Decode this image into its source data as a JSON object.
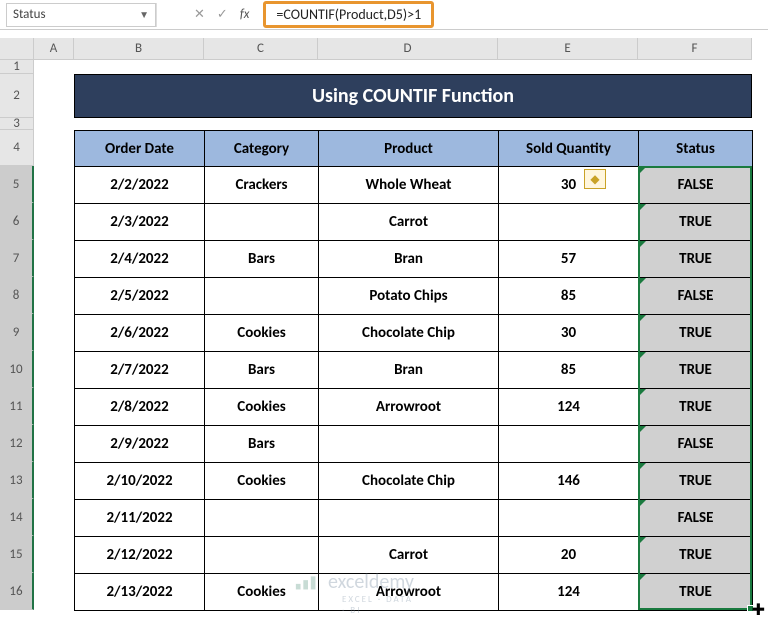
{
  "nameBox": "Status",
  "formula": "=COUNTIF(Product,D5)>1",
  "columns": [
    "A",
    "B",
    "C",
    "D",
    "E",
    "F"
  ],
  "rowNums": [
    "1",
    "2",
    "3",
    "4",
    "5",
    "6",
    "7",
    "8",
    "9",
    "10",
    "11",
    "12",
    "13",
    "14",
    "15",
    "16"
  ],
  "title": "Using COUNTIF Function",
  "headers": {
    "b": "Order Date",
    "c": "Category",
    "d": "Product",
    "e": "Sold Quantity",
    "f": "Status"
  },
  "rows": [
    {
      "b": "2/2/2022",
      "c": "Crackers",
      "d": "Whole Wheat",
      "e": "30",
      "f": "FALSE"
    },
    {
      "b": "2/3/2022",
      "c": "",
      "d": "Carrot",
      "e": "",
      "f": "TRUE"
    },
    {
      "b": "2/4/2022",
      "c": "Bars",
      "d": "Bran",
      "e": "57",
      "f": "TRUE"
    },
    {
      "b": "2/5/2022",
      "c": "",
      "d": "Potato Chips",
      "e": "85",
      "f": "FALSE"
    },
    {
      "b": "2/6/2022",
      "c": "Cookies",
      "d": "Chocolate Chip",
      "e": "30",
      "f": "TRUE"
    },
    {
      "b": "2/7/2022",
      "c": "Bars",
      "d": "Bran",
      "e": "85",
      "f": "TRUE"
    },
    {
      "b": "2/8/2022",
      "c": "Cookies",
      "d": "Arrowroot",
      "e": "124",
      "f": "TRUE"
    },
    {
      "b": "2/9/2022",
      "c": "Bars",
      "d": "",
      "e": "",
      "f": "FALSE"
    },
    {
      "b": "2/10/2022",
      "c": "Cookies",
      "d": "Chocolate Chip",
      "e": "146",
      "f": "TRUE"
    },
    {
      "b": "2/11/2022",
      "c": "",
      "d": "",
      "e": "",
      "f": "FALSE"
    },
    {
      "b": "2/12/2022",
      "c": "",
      "d": "Carrot",
      "e": "20",
      "f": "TRUE"
    },
    {
      "b": "2/13/2022",
      "c": "Cookies",
      "d": "Arrowroot",
      "e": "124",
      "f": "TRUE"
    }
  ],
  "watermark": {
    "name": "exceldemy",
    "tag": "EXCEL · DATA · BI"
  },
  "icons": {
    "cancel": "✕",
    "enter": "✓",
    "fx": "fx",
    "dropdown": "▼",
    "error": "◆",
    "plus": "✚"
  }
}
